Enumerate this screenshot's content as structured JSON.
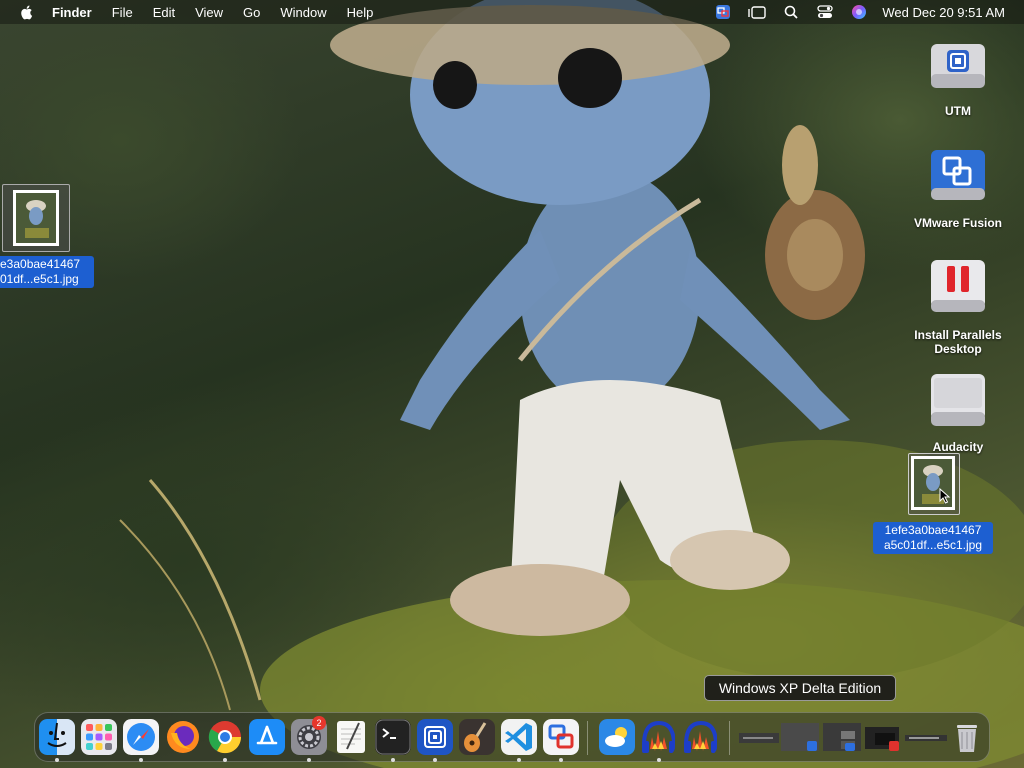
{
  "menubar": {
    "app_name": "Finder",
    "items": [
      "File",
      "Edit",
      "View",
      "Go",
      "Window",
      "Help"
    ],
    "clock": "Wed Dec 20  9:51 AM",
    "status_icons": [
      "screens-icon",
      "stage-manager-icon",
      "spotlight-search-icon",
      "control-center-icon",
      "siri-icon"
    ]
  },
  "desktop": {
    "icons": [
      {
        "name": "utm",
        "label": "UTM"
      },
      {
        "name": "vmware-fusion",
        "label": "VMware Fusion"
      },
      {
        "name": "install-parallels",
        "label_line1": "Install Parallels",
        "label_line2": "Desktop"
      },
      {
        "name": "audacity",
        "label": "Audacity"
      }
    ],
    "files": [
      {
        "label_line1": "e3a0bae41467",
        "label_line2": "01df...e5c1.jpg"
      },
      {
        "label_line1": "1efe3a0bae41467",
        "label_line2": "a5c01df...e5c1.jpg"
      }
    ]
  },
  "tooltip": {
    "text": "Windows XP Delta Edition"
  },
  "dock": {
    "apps": [
      "finder",
      "launchpad",
      "safari",
      "firefox",
      "chrome",
      "app-store",
      "system-settings",
      "textedit",
      "terminal",
      "utm",
      "garageband",
      "vscode",
      "screens",
      "weather",
      "audacity",
      "audacity-2"
    ],
    "system_settings_badge": "2"
  },
  "colors": {
    "selection": "#1d5fd1",
    "accent_red": "#e6362c"
  }
}
